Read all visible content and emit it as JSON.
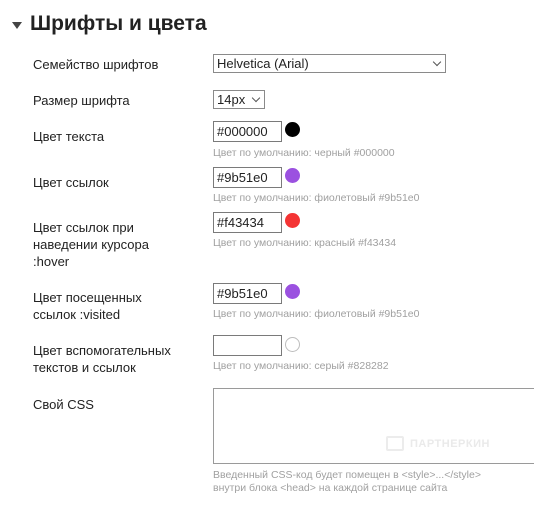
{
  "section": {
    "title": "Шрифты и цвета",
    "toggle_icon": "triangle-down-icon"
  },
  "font_family": {
    "label": "Семейство шрифтов",
    "value": "Helvetica (Arial)"
  },
  "font_size": {
    "label": "Размер шрифта",
    "value": "14px"
  },
  "text_color": {
    "label": "Цвет текста",
    "value": "#000000",
    "swatch": "#000000",
    "hint": "Цвет по умолчанию: черный #000000"
  },
  "link_color": {
    "label": "Цвет ссылок",
    "value": "#9b51e0",
    "swatch": "#9b51e0",
    "hint": "Цвет по умолчанию: фиолетовый #9b51e0"
  },
  "hover_color": {
    "label_lines": [
      "Цвет ссылок при",
      "наведении курсора",
      ":hover"
    ],
    "value": "#f43434",
    "swatch": "#f43434",
    "hint": "Цвет по умолчанию: красный #f43434"
  },
  "visited_color": {
    "label_lines": [
      "Цвет посещенных",
      "ссылок :visited"
    ],
    "value": "#9b51e0",
    "swatch": "#9b51e0",
    "hint": "Цвет по умолчанию: фиолетовый #9b51e0"
  },
  "aux_color": {
    "label_lines": [
      "Цвет вспомогательных",
      "текстов и ссылок"
    ],
    "value": "",
    "hint": "Цвет по умолчанию: серый #828282"
  },
  "custom_css": {
    "label": "Свой CSS",
    "value": "",
    "hint_lines": [
      "Введенный CSS-код будет помещен в <style>...</style>",
      "внутри блока <head> на каждой странице сайта"
    ]
  },
  "watermark": {
    "text": "ПАРТНЕРКИН"
  }
}
